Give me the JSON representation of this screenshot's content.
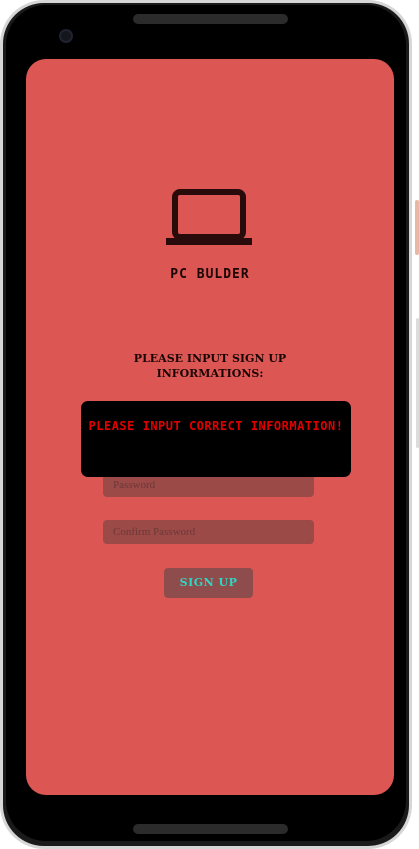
{
  "app": {
    "title": "PC BULDER",
    "prompt": "PLEASE INPUT SIGN UP INFORMATIONS:"
  },
  "form": {
    "password_placeholder": "Password",
    "confirm_password_placeholder": "Confirm Password",
    "signup_label": "SIGN UP"
  },
  "toast": {
    "message": "PLEASE INPUT CORRECT INFORMATION!"
  },
  "colors": {
    "screen_background": "#dc5754",
    "toast_text": "#e00000",
    "signup_text": "#2ed6c4"
  },
  "icons": {
    "logo": "laptop-icon"
  }
}
